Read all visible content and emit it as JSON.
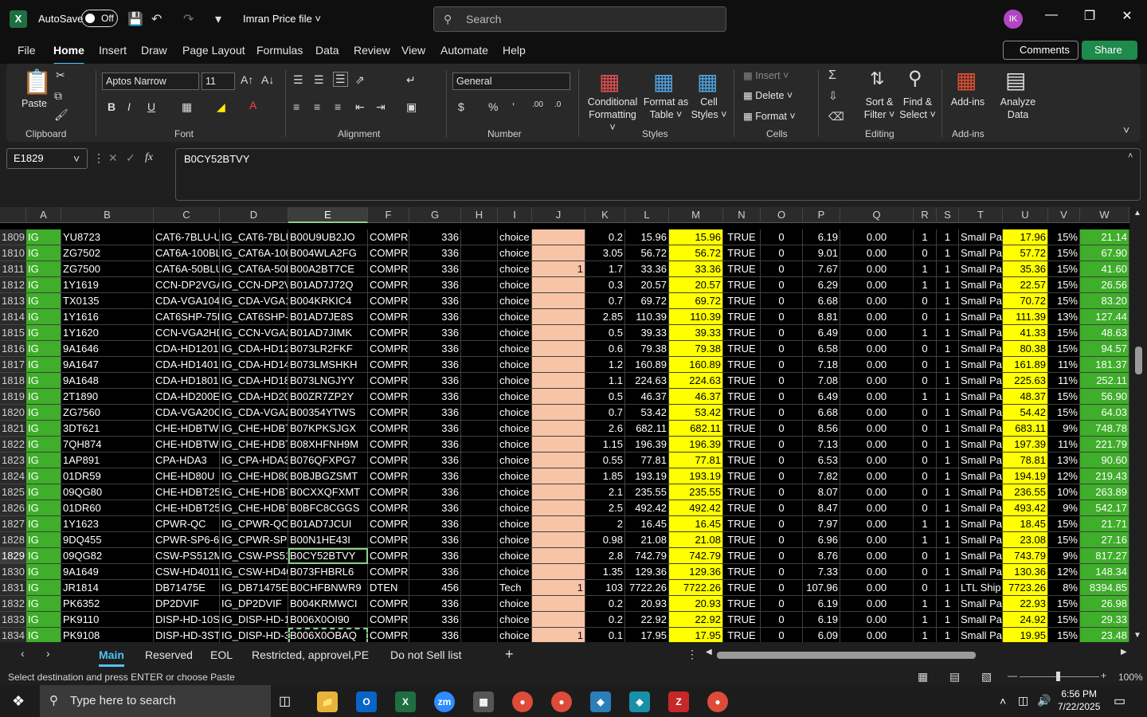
{
  "window": {
    "autosave_label": "AutoSave",
    "autosave_state": "Off",
    "filename": "Imran Price file",
    "search_placeholder": "Search",
    "avatar_initials": "IK"
  },
  "menu": [
    "File",
    "Home",
    "Insert",
    "Draw",
    "Page Layout",
    "Formulas",
    "Data",
    "Review",
    "View",
    "Automate",
    "Help"
  ],
  "top_buttons": {
    "comments": "Comments",
    "share": "Share"
  },
  "ribbon": {
    "clipboard": {
      "label": "Clipboard",
      "paste": "Paste"
    },
    "font": {
      "label": "Font",
      "name": "Aptos Narrow",
      "size": "11"
    },
    "alignment": {
      "label": "Alignment"
    },
    "number": {
      "label": "Number",
      "format": "General"
    },
    "styles": {
      "label": "Styles",
      "conditional": "Conditional",
      "conditional2": "Formatting",
      "format_as": "Format as",
      "format_as2": "Table",
      "cell": "Cell",
      "cell2": "Styles"
    },
    "cells": {
      "label": "Cells",
      "insert": "Insert",
      "delete": "Delete",
      "format": "Format"
    },
    "editing": {
      "label": "Editing",
      "sort": "Sort &",
      "sort2": "Filter",
      "find": "Find &",
      "find2": "Select"
    },
    "addins": {
      "label": "Add-ins",
      "addins": "Add-ins",
      "analyze": "Analyze",
      "analyze2": "Data"
    }
  },
  "formula_bar": {
    "namebox": "E1829",
    "fx": "fx",
    "content": "B0CY52BTVY"
  },
  "columns": [
    "A",
    "B",
    "C",
    "D",
    "E",
    "F",
    "G",
    "H",
    "I",
    "J",
    "K",
    "L",
    "M",
    "N",
    "O",
    "P",
    "Q",
    "R",
    "S",
    "T",
    "U",
    "V",
    "W"
  ],
  "rows": [
    {
      "n": "1809",
      "a": "IG",
      "b": "YU8723",
      "c": "CAT6-7BLU-U",
      "d": "IG_CAT6-7BLU",
      "e": "B00U9UB2JO",
      "f": "COMPRE",
      "g": "336",
      "h": "",
      "i": "choice",
      "j": "",
      "k": "0.2",
      "l": "15.96",
      "m": "15.96",
      "nn": "TRUE",
      "o": "0",
      "p": "6.19",
      "q": "0.00",
      "rr": "1",
      "s": "1",
      "t": "Small Pa",
      "u": "17.96",
      "v": "15%",
      "w": "21.14"
    },
    {
      "n": "1810",
      "a": "IG",
      "b": "ZG7502",
      "c": "CAT6A-100BL",
      "d": "IG_CAT6A-100",
      "e": "B004WLA2FG",
      "f": "COMPRE",
      "g": "336",
      "h": "",
      "i": "choice",
      "j": "",
      "k": "3.05",
      "l": "56.72",
      "m": "56.72",
      "nn": "TRUE",
      "o": "0",
      "p": "9.01",
      "q": "0.00",
      "rr": "0",
      "s": "1",
      "t": "Small Pa",
      "u": "57.72",
      "v": "15%",
      "w": "67.90"
    },
    {
      "n": "1811",
      "a": "IG",
      "b": "ZG7500",
      "c": "CAT6A-50BLU",
      "d": "IG_CAT6A-50E",
      "e": "B00A2BT7CE",
      "f": "COMPRE",
      "g": "336",
      "h": "",
      "i": "choice",
      "j": "1",
      "k": "1.7",
      "l": "33.36",
      "m": "33.36",
      "nn": "TRUE",
      "o": "0",
      "p": "7.67",
      "q": "0.00",
      "rr": "1",
      "s": "1",
      "t": "Small Pa",
      "u": "35.36",
      "v": "15%",
      "w": "41.60"
    },
    {
      "n": "1812",
      "a": "IG",
      "b": "1Y1619",
      "c": "CCN-DP2VGA",
      "d": "IG_CCN-DP2V",
      "e": "B01AD7J72Q",
      "f": "COMPRE",
      "g": "336",
      "h": "",
      "i": "choice",
      "j": "",
      "k": "0.3",
      "l": "20.57",
      "m": "20.57",
      "nn": "TRUE",
      "o": "0",
      "p": "6.29",
      "q": "0.00",
      "rr": "1",
      "s": "1",
      "t": "Small Pa",
      "u": "22.57",
      "v": "15%",
      "w": "26.56"
    },
    {
      "n": "1813",
      "a": "IG",
      "b": "TX0135",
      "c": "CDA-VGA104I",
      "d": "IG_CDA-VGA1",
      "e": "B004KRKIC4",
      "f": "COMPRE",
      "g": "336",
      "h": "",
      "i": "choice",
      "j": "",
      "k": "0.7",
      "l": "69.72",
      "m": "69.72",
      "nn": "TRUE",
      "o": "0",
      "p": "6.68",
      "q": "0.00",
      "rr": "0",
      "s": "1",
      "t": "Small Pa",
      "u": "70.72",
      "v": "15%",
      "w": "83.20"
    },
    {
      "n": "1814",
      "a": "IG",
      "b": "1Y1616",
      "c": "CAT6SHP-75B",
      "d": "IG_CAT6SHP-7",
      "e": "B01AD7JE8S",
      "f": "COMPRE",
      "g": "336",
      "h": "",
      "i": "choice",
      "j": "",
      "k": "2.85",
      "l": "110.39",
      "m": "110.39",
      "nn": "TRUE",
      "o": "0",
      "p": "8.81",
      "q": "0.00",
      "rr": "0",
      "s": "1",
      "t": "Small Pa",
      "u": "111.39",
      "v": "13%",
      "w": "127.44"
    },
    {
      "n": "1815",
      "a": "IG",
      "b": "1Y1620",
      "c": "CCN-VGA2HD",
      "d": "IG_CCN-VGA2",
      "e": "B01AD7JIMK",
      "f": "COMPRE",
      "g": "336",
      "h": "",
      "i": "choice",
      "j": "",
      "k": "0.5",
      "l": "39.33",
      "m": "39.33",
      "nn": "TRUE",
      "o": "0",
      "p": "6.49",
      "q": "0.00",
      "rr": "1",
      "s": "1",
      "t": "Small Pa",
      "u": "41.33",
      "v": "15%",
      "w": "48.63"
    },
    {
      "n": "1816",
      "a": "IG",
      "b": "9A1646",
      "c": "CDA-HD12018",
      "d": "IG_CDA-HD12",
      "e": "B073LR2FKF",
      "f": "COMPRE",
      "g": "336",
      "h": "",
      "i": "choice",
      "j": "",
      "k": "0.6",
      "l": "79.38",
      "m": "79.38",
      "nn": "TRUE",
      "o": "0",
      "p": "6.58",
      "q": "0.00",
      "rr": "0",
      "s": "1",
      "t": "Small Pa",
      "u": "80.38",
      "v": "15%",
      "w": "94.57"
    },
    {
      "n": "1817",
      "a": "IG",
      "b": "9A1647",
      "c": "CDA-HD14018",
      "d": "IG_CDA-HD14",
      "e": "B073LMSHKH",
      "f": "COMPRE",
      "g": "336",
      "h": "",
      "i": "choice",
      "j": "",
      "k": "1.2",
      "l": "160.89",
      "m": "160.89",
      "nn": "TRUE",
      "o": "0",
      "p": "7.18",
      "q": "0.00",
      "rr": "0",
      "s": "1",
      "t": "Small Pa",
      "u": "161.89",
      "v": "11%",
      "w": "181.37"
    },
    {
      "n": "1818",
      "a": "IG",
      "b": "9A1648",
      "c": "CDA-HD18018",
      "d": "IG_CDA-HD18",
      "e": "B073LNGJYY",
      "f": "COMPRE",
      "g": "336",
      "h": "",
      "i": "choice",
      "j": "",
      "k": "1.1",
      "l": "224.63",
      "m": "224.63",
      "nn": "TRUE",
      "o": "0",
      "p": "7.08",
      "q": "0.00",
      "rr": "0",
      "s": "1",
      "t": "Small Pa",
      "u": "225.63",
      "v": "11%",
      "w": "252.11"
    },
    {
      "n": "1819",
      "a": "IG",
      "b": "2T1890",
      "c": "CDA-HD200E",
      "d": "IG_CDA-HD20",
      "e": "B00ZR7ZP2Y",
      "f": "COMPRE",
      "g": "336",
      "h": "",
      "i": "choice",
      "j": "",
      "k": "0.5",
      "l": "46.37",
      "m": "46.37",
      "nn": "TRUE",
      "o": "0",
      "p": "6.49",
      "q": "0.00",
      "rr": "1",
      "s": "1",
      "t": "Small Pa",
      "u": "48.37",
      "v": "15%",
      "w": "56.90"
    },
    {
      "n": "1820",
      "a": "IG",
      "b": "ZG7560",
      "c": "CDA-VGA20C",
      "d": "IG_CDA-VGA2",
      "e": "B00354YTWS",
      "f": "COMPRE",
      "g": "336",
      "h": "",
      "i": "choice",
      "j": "",
      "k": "0.7",
      "l": "53.42",
      "m": "53.42",
      "nn": "TRUE",
      "o": "0",
      "p": "6.68",
      "q": "0.00",
      "rr": "0",
      "s": "1",
      "t": "Small Pa",
      "u": "54.42",
      "v": "15%",
      "w": "64.03"
    },
    {
      "n": "1821",
      "a": "IG",
      "b": "3DT621",
      "c": "CHE-HDBTWF",
      "d": "IG_CHE-HDBT",
      "e": "B07KPKSJGX",
      "f": "COMPRE",
      "g": "336",
      "h": "",
      "i": "choice",
      "j": "",
      "k": "2.6",
      "l": "682.11",
      "m": "682.11",
      "nn": "TRUE",
      "o": "0",
      "p": "8.56",
      "q": "0.00",
      "rr": "0",
      "s": "1",
      "t": "Small Pa",
      "u": "683.11",
      "v": "9%",
      "w": "748.78"
    },
    {
      "n": "1822",
      "a": "IG",
      "b": "7QH874",
      "c": "CHE-HDBTWF",
      "d": "IG_CHE-HDBT",
      "e": "B08XHFNH9M",
      "f": "COMPRE",
      "g": "336",
      "h": "",
      "i": "choice",
      "j": "",
      "k": "1.15",
      "l": "196.39",
      "m": "196.39",
      "nn": "TRUE",
      "o": "0",
      "p": "7.13",
      "q": "0.00",
      "rr": "0",
      "s": "1",
      "t": "Small Pa",
      "u": "197.39",
      "v": "11%",
      "w": "221.79"
    },
    {
      "n": "1823",
      "a": "IG",
      "b": "1AP891",
      "c": "CPA-HDA3",
      "d": "IG_CPA-HDA3",
      "e": "B076QFXPG7",
      "f": "COMPRE",
      "g": "336",
      "h": "",
      "i": "choice",
      "j": "",
      "k": "0.55",
      "l": "77.81",
      "m": "77.81",
      "nn": "TRUE",
      "o": "0",
      "p": "6.53",
      "q": "0.00",
      "rr": "0",
      "s": "1",
      "t": "Small Pa",
      "u": "78.81",
      "v": "13%",
      "w": "90.60"
    },
    {
      "n": "1824",
      "a": "IG",
      "b": "01DR59",
      "c": "CHE-HD80U",
      "d": "IG_CHE-HD80",
      "e": "B0BJBGZSMT",
      "f": "COMPRE",
      "g": "336",
      "h": "",
      "i": "choice",
      "j": "",
      "k": "1.85",
      "l": "193.19",
      "m": "193.19",
      "nn": "TRUE",
      "o": "0",
      "p": "7.82",
      "q": "0.00",
      "rr": "0",
      "s": "1",
      "t": "Small Pa",
      "u": "194.19",
      "v": "12%",
      "w": "219.43"
    },
    {
      "n": "1825",
      "a": "IG",
      "b": "09QG80",
      "c": "CHE-HDBT250",
      "d": "IG_CHE-HDBT",
      "e": "B0CXXQFXMT",
      "f": "COMPRE",
      "g": "336",
      "h": "",
      "i": "choice",
      "j": "",
      "k": "2.1",
      "l": "235.55",
      "m": "235.55",
      "nn": "TRUE",
      "o": "0",
      "p": "8.07",
      "q": "0.00",
      "rr": "0",
      "s": "1",
      "t": "Small Pa",
      "u": "236.55",
      "v": "10%",
      "w": "263.89"
    },
    {
      "n": "1826",
      "a": "IG",
      "b": "01DR60",
      "c": "CHE-HDBT255",
      "d": "IG_CHE-HDBT",
      "e": "B0BFC8CGGS",
      "f": "COMPRE",
      "g": "336",
      "h": "",
      "i": "choice",
      "j": "",
      "k": "2.5",
      "l": "492.42",
      "m": "492.42",
      "nn": "TRUE",
      "o": "0",
      "p": "8.47",
      "q": "0.00",
      "rr": "0",
      "s": "1",
      "t": "Small Pa",
      "u": "493.42",
      "v": "9%",
      "w": "542.17"
    },
    {
      "n": "1827",
      "a": "IG",
      "b": "1Y1623",
      "c": "CPWR-QC",
      "d": "IG_CPWR-QC",
      "e": "B01AD7JCUI",
      "f": "COMPRE",
      "g": "336",
      "h": "",
      "i": "choice",
      "j": "",
      "k": "2",
      "l": "16.45",
      "m": "16.45",
      "nn": "TRUE",
      "o": "0",
      "p": "7.97",
      "q": "0.00",
      "rr": "1",
      "s": "1",
      "t": "Small Pa",
      "u": "18.45",
      "v": "15%",
      "w": "21.71"
    },
    {
      "n": "1828",
      "a": "IG",
      "b": "9DQ455",
      "c": "CPWR-SP6-6E",
      "d": "IG_CPWR-SP6",
      "e": "B00N1HE43I",
      "f": "COMPRE",
      "g": "336",
      "h": "",
      "i": "choice",
      "j": "",
      "k": "0.98",
      "l": "21.08",
      "m": "21.08",
      "nn": "TRUE",
      "o": "0",
      "p": "6.96",
      "q": "0.00",
      "rr": "1",
      "s": "1",
      "t": "Small Pa",
      "u": "23.08",
      "v": "15%",
      "w": "27.16"
    },
    {
      "n": "1829",
      "a": "IG",
      "b": "09QG82",
      "c": "CSW-PS512M",
      "d": "IG_CSW-PS51",
      "e": "B0CY52BTVY",
      "f": "COMPRE",
      "g": "336",
      "h": "",
      "i": "choice",
      "j": "",
      "k": "2.8",
      "l": "742.79",
      "m": "742.79",
      "nn": "TRUE",
      "o": "0",
      "p": "8.76",
      "q": "0.00",
      "rr": "0",
      "s": "1",
      "t": "Small Pa",
      "u": "743.79",
      "v": "9%",
      "w": "817.27"
    },
    {
      "n": "1830",
      "a": "IG",
      "b": "9A1649",
      "c": "CSW-HD4011",
      "d": "IG_CSW-HD40",
      "e": "B073FHBRL6",
      "f": "COMPRE",
      "g": "336",
      "h": "",
      "i": "choice",
      "j": "",
      "k": "1.35",
      "l": "129.36",
      "m": "129.36",
      "nn": "TRUE",
      "o": "0",
      "p": "7.33",
      "q": "0.00",
      "rr": "0",
      "s": "1",
      "t": "Small Pa",
      "u": "130.36",
      "v": "12%",
      "w": "148.34"
    },
    {
      "n": "1831",
      "a": "IG",
      "b": "JR1814",
      "c": "DB71475E",
      "d": "IG_DB71475E",
      "e": "B0CHFBNWR9",
      "f": "DTEN",
      "g": "456",
      "h": "",
      "i": "Tech",
      "j": "1",
      "k": "103",
      "l": "7722.26",
      "m": "7722.26",
      "nn": "TRUE",
      "o": "0",
      "p": "107.96",
      "q": "0.00",
      "rr": "0",
      "s": "1",
      "t": "LTL Ship",
      "u": "7723.26",
      "v": "8%",
      "w": "8394.85"
    },
    {
      "n": "1832",
      "a": "IG",
      "b": "PK6352",
      "c": "DP2DVIF",
      "d": "IG_DP2DVIF",
      "e": "B004KRMWCI",
      "f": "COMPRE",
      "g": "336",
      "h": "",
      "i": "choice",
      "j": "",
      "k": "0.2",
      "l": "20.93",
      "m": "20.93",
      "nn": "TRUE",
      "o": "0",
      "p": "6.19",
      "q": "0.00",
      "rr": "1",
      "s": "1",
      "t": "Small Pa",
      "u": "22.93",
      "v": "15%",
      "w": "26.98"
    },
    {
      "n": "1833",
      "a": "IG",
      "b": "PK9110",
      "c": "DISP-HD-10S",
      "d": "IG_DISP-HD-1",
      "e": "B006X0OI90",
      "f": "COMPRE",
      "g": "336",
      "h": "",
      "i": "choice",
      "j": "",
      "k": "0.2",
      "l": "22.92",
      "m": "22.92",
      "nn": "TRUE",
      "o": "0",
      "p": "6.19",
      "q": "0.00",
      "rr": "1",
      "s": "1",
      "t": "Small Pa",
      "u": "24.92",
      "v": "15%",
      "w": "29.33"
    },
    {
      "n": "1834",
      "a": "IG",
      "b": "PK9108",
      "c": "DISP-HD-3ST",
      "d": "IG_DISP-HD-3",
      "e": "B006X0OBAQ",
      "f": "COMPRE",
      "g": "336",
      "h": "",
      "i": "choice",
      "j": "1",
      "k": "0.1",
      "l": "17.95",
      "m": "17.95",
      "nn": "TRUE",
      "o": "0",
      "p": "6.09",
      "q": "0.00",
      "rr": "1",
      "s": "1",
      "t": "Small Pa",
      "u": "19.95",
      "v": "15%",
      "w": "23.48"
    }
  ],
  "sheets": [
    "Main",
    "Reserved",
    "EOL",
    "Restricted, approvel,PE",
    "Do not Sell list"
  ],
  "status": {
    "message": "Select destination and press ENTER or choose Paste",
    "zoom": "100%"
  },
  "taskbar": {
    "search_placeholder": "Type here to search",
    "time": "6:56 PM",
    "date": "7/22/2025"
  }
}
